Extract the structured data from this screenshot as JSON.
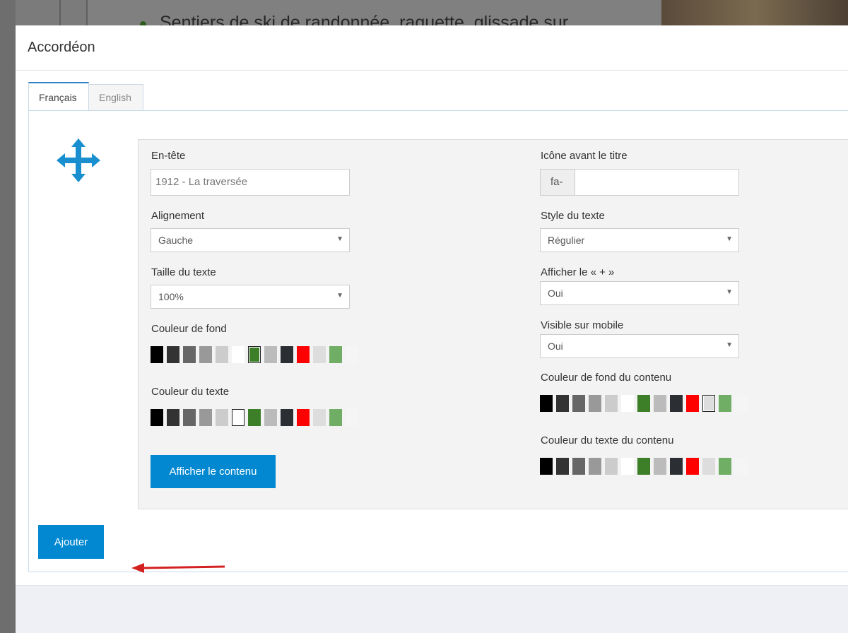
{
  "background": {
    "text": "Sentiers de ski de randonnée, raquette, glissade sur"
  },
  "modal": {
    "title": "Accordéon",
    "tabs": [
      {
        "label": "Français",
        "active": true
      },
      {
        "label": "English",
        "active": false
      }
    ],
    "move_icon": "arrows-move-icon",
    "fields": {
      "header": {
        "label": "En-tête",
        "value": "1912 - La traversée"
      },
      "icon_before_title": {
        "label": "Icône avant le titre",
        "prefix": "fa-",
        "value": ""
      },
      "alignment": {
        "label": "Alignement",
        "value": "Gauche"
      },
      "text_style": {
        "label": "Style du texte",
        "value": "Régulier"
      },
      "text_size": {
        "label": "Taille du texte",
        "value": "100%"
      },
      "show_plus": {
        "label": "Afficher le « + »",
        "value": "Oui"
      },
      "visible_mobile": {
        "label": "Visible sur mobile",
        "value": "Oui"
      },
      "bg_color": {
        "label": "Couleur de fond",
        "selected": 6
      },
      "text_color": {
        "label": "Couleur du texte",
        "selected": 5
      },
      "content_bg_color": {
        "label": "Couleur de fond du contenu",
        "selected": 10
      },
      "content_text_color": {
        "label": "Couleur du texte du contenu",
        "selected": -1
      }
    },
    "palette": [
      "#000000",
      "#333333",
      "#666666",
      "#999999",
      "#cccccc",
      "#ffffff",
      "#3d7f28",
      "#bbbbbb",
      "#2b2e33",
      "#ff0000",
      "#dddddd",
      "#6fae64",
      "#f5f5f5"
    ],
    "show_content_button": "Afficher le contenu",
    "add_button": "Ajouter",
    "accent_color": "#0288d1",
    "arrow_color": "#d32020"
  }
}
